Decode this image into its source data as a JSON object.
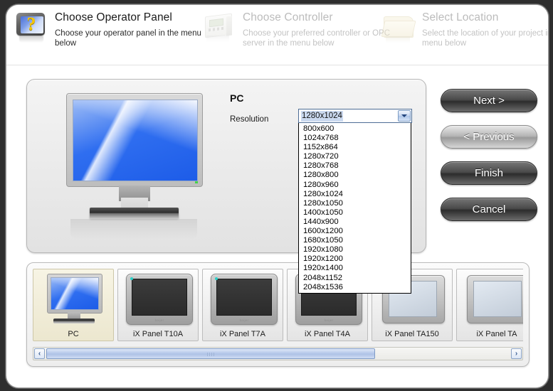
{
  "window": {
    "title": "Choose Operator Panel"
  },
  "header": {
    "steps": [
      {
        "title": "Choose Operator Panel",
        "desc": "Choose your operator panel in the menu below",
        "icon": "operator-panel-question-icon",
        "state": "active"
      },
      {
        "title": "Choose Controller",
        "desc": "Choose your preferred controller or OPC server in the menu below",
        "icon": "controller-icon",
        "state": "inactive"
      },
      {
        "title": "Select Location",
        "desc": "Select the location of your project in the menu below",
        "icon": "folder-icon",
        "state": "inactive"
      }
    ]
  },
  "main": {
    "preview_icon": "desktop-monitor-icon",
    "panel_title": "PC",
    "resolution_label": "Resolution",
    "resolution": {
      "value": "1280x1024",
      "expanded": true,
      "arrow_icon": "chevron-down-icon",
      "options": [
        "800x600",
        "1024x768",
        "1152x864",
        "1280x720",
        "1280x768",
        "1280x800",
        "1280x960",
        "1280x1024",
        "1280x1050",
        "1400x1050",
        "1440x900",
        "1600x1200",
        "1680x1050",
        "1920x1080",
        "1920x1200",
        "1920x1400",
        "2048x1152",
        "2048x1536"
      ]
    }
  },
  "buttons": [
    {
      "label": "Next >",
      "style": "dark"
    },
    {
      "label": "< Previous",
      "style": "light"
    },
    {
      "label": "Finish",
      "style": "dark"
    },
    {
      "label": "Cancel",
      "style": "dark"
    }
  ],
  "gallery": {
    "items": [
      {
        "label": "PC",
        "art": "pc",
        "selected": true
      },
      {
        "label": "iX Panel T10A",
        "art": "dark",
        "selected": false
      },
      {
        "label": "iX Panel T7A",
        "art": "dark",
        "selected": false
      },
      {
        "label": "iX Panel T4A",
        "art": "dark",
        "selected": false
      },
      {
        "label": "iX Panel TA150",
        "art": "light",
        "selected": false
      },
      {
        "label": "iX Panel TA",
        "art": "light",
        "selected": false
      }
    ],
    "scrollbar": {
      "left_arrow_icon": "chevron-left-icon",
      "right_arrow_icon": "chevron-right-icon",
      "left_arrow_glyph": "‹",
      "right_arrow_glyph": "›"
    }
  },
  "colors": {
    "accent": "#4d6d96",
    "selection": "#cbd9ef",
    "selected_thumb": "#ece7cf",
    "window_border": "#2e2e2e"
  }
}
